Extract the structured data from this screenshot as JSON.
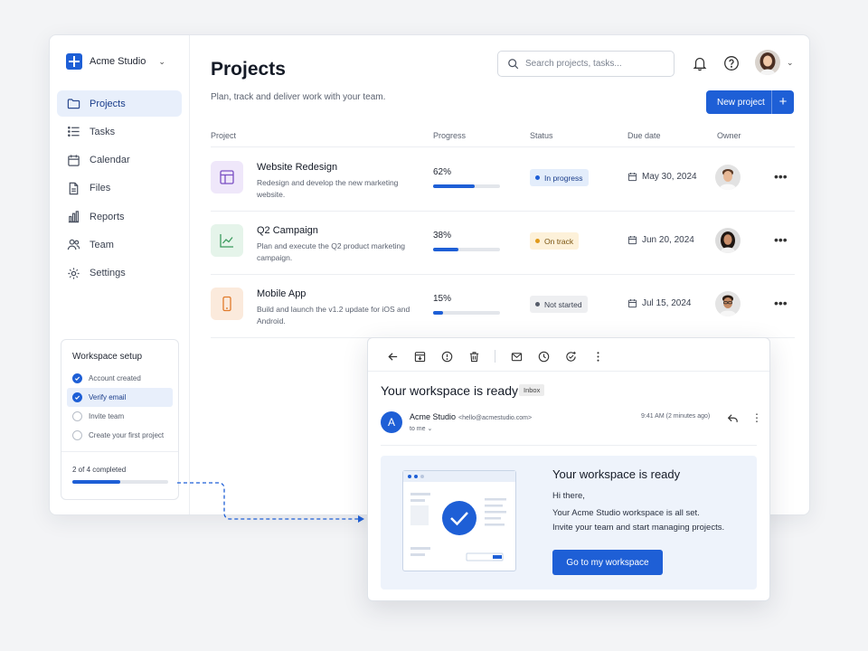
{
  "colors": {
    "accent": "#1e5fd6",
    "active_bg": "#e8effb"
  },
  "workspace": {
    "name": "Acme Studio"
  },
  "sidebar": {
    "items": [
      {
        "label": "Projects",
        "icon": "folder-icon",
        "active": true
      },
      {
        "label": "Tasks",
        "icon": "list-icon"
      },
      {
        "label": "Calendar",
        "icon": "calendar-icon"
      },
      {
        "label": "Files",
        "icon": "file-icon"
      },
      {
        "label": "Reports",
        "icon": "bar-chart-icon"
      },
      {
        "label": "Team",
        "icon": "users-icon"
      },
      {
        "label": "Settings",
        "icon": "gear-icon"
      }
    ]
  },
  "setup": {
    "title": "Workspace setup",
    "items": [
      {
        "label": "Account created",
        "done": true
      },
      {
        "label": "Verify email",
        "done": true,
        "active": true
      },
      {
        "label": "Invite team",
        "done": false
      },
      {
        "label": "Create your first project",
        "done": false
      }
    ],
    "progress_text": "2 of 4 completed",
    "progress": 0.5
  },
  "header": {
    "title": "Projects",
    "subtitle": "Plan, track and deliver work with your team.",
    "search_placeholder": "Search projects, tasks...",
    "new_button": "New project",
    "new_button_plus": "+"
  },
  "table": {
    "columns": [
      "Project",
      "Progress",
      "Status",
      "Due date",
      "Owner"
    ],
    "rows": [
      {
        "title": "Website Redesign",
        "desc": "Redesign and develop the new marketing website.",
        "progress": "62%",
        "progress_value": 0.62,
        "status": "In progress",
        "status_color": "#1e5fd6",
        "due": "May 30, 2024",
        "icon": "layout-icon",
        "icon_color": "#7a4fc4",
        "icon_bg": "#efe7fa"
      },
      {
        "title": "Q2 Campaign",
        "desc": "Plan and execute the Q2 product marketing campaign.",
        "progress": "38%",
        "progress_value": 0.38,
        "status": "On track",
        "status_color": "#e09a1a",
        "due": "Jun 20, 2024",
        "icon": "trend-icon",
        "icon_color": "#3a9a5c",
        "icon_bg": "#e5f4ea"
      },
      {
        "title": "Mobile App",
        "desc": "Build and launch the v1.2 update for iOS and Android.",
        "progress": "15%",
        "progress_value": 0.15,
        "status": "Not started",
        "status_color": "#555c6a",
        "due": "Jul 15, 2024",
        "icon": "phone-icon",
        "icon_color": "#e07a2a",
        "icon_bg": "#fbeadc"
      }
    ],
    "more_glyph": "•••"
  },
  "email": {
    "subject": "Your workspace is ready",
    "label": "Inbox",
    "sender_initial": "A",
    "sender_name": "Acme Studio",
    "sender_email": "<hello@acmestudio.com>",
    "to": "to me ⌄",
    "time": "9:41 AM (2 minutes ago)",
    "more_glyph": "⋮",
    "body": {
      "title": "Your workspace is ready",
      "greeting": "Hi there,",
      "line1": "Your Acme Studio workspace is all set.",
      "line2": "Invite your team and start managing projects.",
      "button": "Go to my workspace"
    }
  }
}
